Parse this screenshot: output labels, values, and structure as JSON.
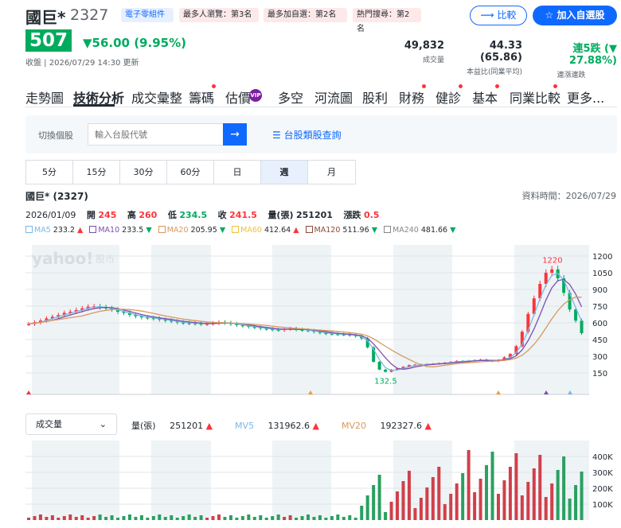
{
  "header": {
    "name": "國巨*",
    "code": "2327",
    "tags": [
      {
        "text": "電子零組件",
        "color": "#0f69ff",
        "bg": "#e7f0ff"
      },
      {
        "text": "最多人瀏覽：第3名",
        "color": "#232a31",
        "bg": "#fde9ea"
      },
      {
        "text": "最多加自選：第2名",
        "color": "#232a31",
        "bg": "#fde9ea"
      },
      {
        "text": "熱門搜尋：第2名",
        "color": "#232a31",
        "bg": "#fde9ea"
      }
    ],
    "compare_label": "比較",
    "add_label": "加入自選股"
  },
  "quote": {
    "price": "507",
    "change": "▼56.00 (9.95%)",
    "sub": "收盤 | 2026/07/29 14:30 更新",
    "stats": [
      {
        "value": "49,832",
        "label": "成交量"
      },
      {
        "value": "44.33 (65.86)",
        "label": "本益比(同業平均)"
      },
      {
        "value": "連5跌 (▼ 27.88%)",
        "label": "連漲連跌"
      }
    ]
  },
  "tabs": [
    "走勢圖",
    "技術分析",
    "成交彙整",
    "籌碼",
    "估價",
    "多空",
    "河流圖",
    "股利",
    "財務",
    "健診",
    "基本",
    "同業比較",
    "更多..."
  ],
  "vip_label": "VIP",
  "search": {
    "switch_label": "切換個股",
    "placeholder": "輸入台股代號",
    "category_link": "台股類股查詢"
  },
  "periods": [
    "5分",
    "15分",
    "30分",
    "60分",
    "日",
    "週",
    "月"
  ],
  "chart_header": {
    "name": "國巨* (2327)",
    "time": "資料時間：2026/07/29"
  },
  "ohlc": {
    "date": "2026/01/09",
    "open_label": "開",
    "open": "245",
    "high_label": "高",
    "high": "260",
    "low_label": "低",
    "low": "234.5",
    "close_label": "收",
    "close": "241.5",
    "vol_label": "量(張)",
    "vol": "251201",
    "chg_label": "漲跌",
    "chg": "0.5"
  },
  "ma": [
    {
      "label": "MA5",
      "value": "233.2",
      "dir": "▲",
      "color": "#7ab8e6"
    },
    {
      "label": "MA10",
      "value": "233.5",
      "dir": "▼",
      "color": "#7b4fb0"
    },
    {
      "label": "MA20",
      "value": "205.95",
      "dir": "▼",
      "color": "#d7995c"
    },
    {
      "label": "MA60",
      "value": "412.64",
      "dir": "▲",
      "color": "#f0c040"
    },
    {
      "label": "MA120",
      "value": "511.96",
      "dir": "▼",
      "color": "#8b4a3a"
    },
    {
      "label": "MA240",
      "value": "481.66",
      "dir": "▼",
      "color": "#888888"
    }
  ],
  "watermark": {
    "brand": "yahoo!",
    "suffix": "股市"
  },
  "chart_data": {
    "type": "candlestick",
    "y_ticks": [
      150,
      300,
      450,
      600,
      750,
      900,
      1050,
      1200
    ],
    "max_label": "1220",
    "min_label": "132.5",
    "close": [
      590,
      605,
      620,
      640,
      655,
      670,
      690,
      700,
      715,
      730,
      745,
      748,
      740,
      730,
      720,
      700,
      690,
      672,
      660,
      650,
      645,
      640,
      630,
      622,
      615,
      605,
      600,
      598,
      595,
      590,
      592,
      598,
      605,
      600,
      590,
      580,
      575,
      565,
      560,
      550,
      545,
      540,
      535,
      545,
      548,
      540,
      536,
      530,
      520,
      510,
      505,
      500,
      498,
      495,
      490,
      480,
      460,
      380,
      250,
      180,
      160,
      180,
      190,
      205,
      220,
      225,
      228,
      230,
      232,
      238,
      242,
      250,
      258,
      255,
      260,
      265,
      270,
      262,
      255,
      265,
      290,
      320,
      390,
      520,
      680,
      820,
      950,
      1050,
      1080,
      1000,
      870,
      720,
      620,
      507
    ]
  },
  "volume": {
    "select_label": "成交量",
    "items": [
      {
        "label": "量(張)",
        "value": "251201",
        "dir": "▲",
        "color": "#232a31"
      },
      {
        "label": "MV5",
        "value": "131962.6",
        "dir": "▲",
        "color": "#7ab8e6"
      },
      {
        "label": "MV20",
        "value": "192327.6",
        "dir": "▲",
        "color": "#d7995c"
      }
    ],
    "y_ticks": [
      "100K",
      "200K",
      "300K",
      "400K"
    ]
  }
}
